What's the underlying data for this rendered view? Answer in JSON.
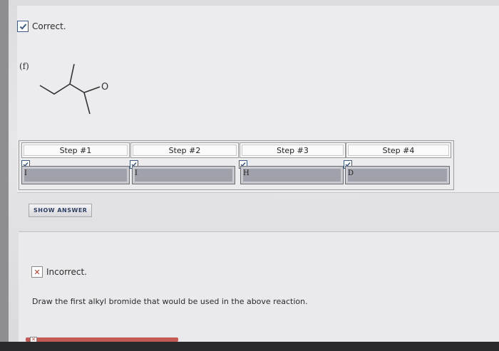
{
  "status_correct": {
    "label": "Correct."
  },
  "question": {
    "part_label": "(f)",
    "atom_label": "O"
  },
  "steps": [
    {
      "header": "Step #1",
      "answer": "I"
    },
    {
      "header": "Step #2",
      "answer": "I"
    },
    {
      "header": "Step #3",
      "answer": "H"
    },
    {
      "header": "Step #4",
      "answer": "D"
    }
  ],
  "show_answer": {
    "label": "SHOW ANSWER"
  },
  "status_incorrect": {
    "label": "Incorrect."
  },
  "prompt": {
    "text": "Draw the first alkyl bromide that would be used in the above reaction."
  },
  "icons": {
    "correct": "check-icon",
    "incorrect": "x-icon"
  },
  "colors": {
    "answer_box": "#9fa2aa",
    "check": "#3d5a88",
    "incorrect": "#c0392b"
  }
}
